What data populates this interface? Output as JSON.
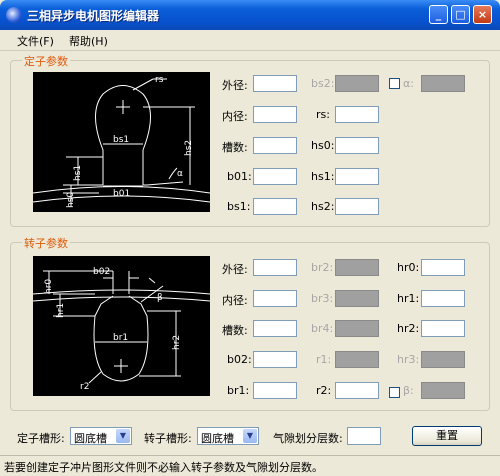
{
  "window": {
    "title": "三相异步电机图形编辑器",
    "minimize": "_",
    "maximize": "□",
    "close": "×"
  },
  "menu": [
    {
      "label": "文件(F)"
    },
    {
      "label": "帮助(H)"
    }
  ],
  "stator": {
    "group_title": "定子参数",
    "diagram_labels": {
      "rs": "rs",
      "bs1": "bs1",
      "hs1": "hs1",
      "hs2": "hs2",
      "hs0": "hs0",
      "b01": "b01",
      "alpha": "α"
    },
    "fields": {
      "outer_diameter": {
        "label": "外径:",
        "value": ""
      },
      "bs2": {
        "label": "bs2:",
        "value": ""
      },
      "alpha": {
        "label": "α:",
        "value": ""
      },
      "inner_diameter": {
        "label": "内径:",
        "value": ""
      },
      "rs": {
        "label": "rs:",
        "value": ""
      },
      "slots": {
        "label": "槽数:",
        "value": ""
      },
      "hs0": {
        "label": "hs0:",
        "value": ""
      },
      "b01": {
        "label": "b01:",
        "value": ""
      },
      "hs1": {
        "label": "hs1:",
        "value": ""
      },
      "bs1": {
        "label": "bs1:",
        "value": ""
      },
      "hs2": {
        "label": "hs2:",
        "value": ""
      }
    }
  },
  "rotor": {
    "group_title": "转子参数",
    "diagram_labels": {
      "hr0": "hr0",
      "b02": "b02",
      "hr1": "hr1",
      "hr2": "hr2",
      "br1": "br1",
      "r2": "r2",
      "beta": "β"
    },
    "fields": {
      "outer_diameter": {
        "label": "外径:",
        "value": ""
      },
      "br2": {
        "label": "br2:",
        "value": ""
      },
      "hr0": {
        "label": "hr0:",
        "value": ""
      },
      "inner_diameter": {
        "label": "内径:",
        "value": ""
      },
      "br3": {
        "label": "br3:",
        "value": ""
      },
      "hr1": {
        "label": "hr1:",
        "value": ""
      },
      "slots": {
        "label": "槽数:",
        "value": ""
      },
      "br4": {
        "label": "br4:",
        "value": ""
      },
      "hr2": {
        "label": "hr2:",
        "value": ""
      },
      "b02": {
        "label": "b02:",
        "value": ""
      },
      "r1": {
        "label": "r1:",
        "value": ""
      },
      "hr3": {
        "label": "hr3:",
        "value": ""
      },
      "br1": {
        "label": "br1:",
        "value": ""
      },
      "r2": {
        "label": "r2:",
        "value": ""
      },
      "beta": {
        "label": "β:",
        "value": ""
      }
    }
  },
  "bottom": {
    "stator_slot_label": "定子槽形:",
    "stator_slot_value": "圆底槽",
    "rotor_slot_label": "转子槽形:",
    "rotor_slot_value": "圆底槽",
    "airgap_label": "气隙划分层数:",
    "airgap_value": "",
    "reset_label": "重置"
  },
  "status": {
    "text": "若要创建定子冲片图形文件则不必输入转子参数及气隙划分层数。"
  },
  "colors": {
    "group_title": "#e05a0a",
    "titlebar": "#0a5fd8",
    "disabled_field": "#a0a0a0"
  }
}
